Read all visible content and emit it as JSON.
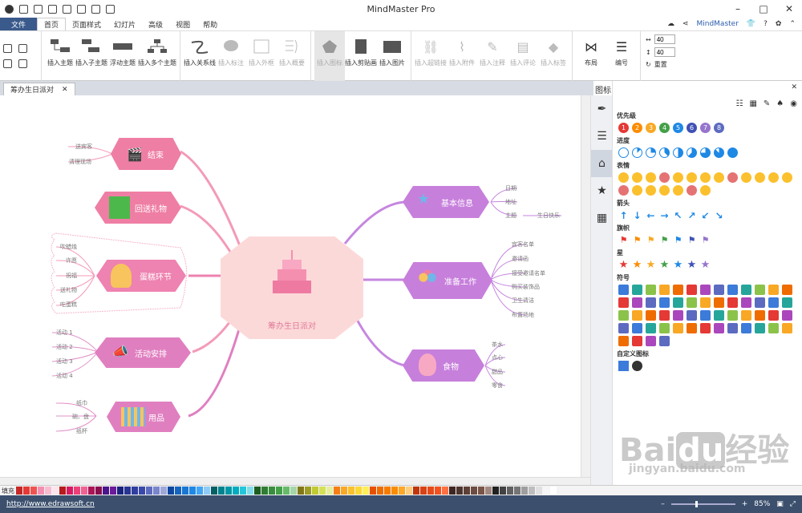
{
  "app": {
    "title": "MindMaster Pro",
    "brand": "MindMaster"
  },
  "menu": {
    "file": "文件",
    "tabs": [
      "首页",
      "页面样式",
      "幻灯片",
      "高级",
      "视图",
      "帮助"
    ]
  },
  "ribbon": {
    "buttons": [
      "插入主题",
      "插入子主题",
      "浮动主题",
      "插入多个主题",
      "插入关系线",
      "插入标注",
      "插入外框",
      "插入概要",
      "插入图标",
      "插入剪贴画",
      "插入图片",
      "插入超链接",
      "插入附件",
      "插入注释",
      "插入评论",
      "插入标签",
      "布局",
      "编号"
    ],
    "width_value": "40",
    "height_value": "40",
    "reset": "重置"
  },
  "doc": {
    "tab": "筹办生日派对"
  },
  "map": {
    "central": "筹办生日派对",
    "branches": [
      {
        "label": "结束",
        "leaves": [
          "送宾客",
          "清理现场"
        ]
      },
      {
        "label": "回送礼物",
        "leaves": []
      },
      {
        "label": "蛋糕环节",
        "leaves": [
          "吹蜡烛",
          "许愿",
          "祝福",
          "送礼物",
          "吃蛋糕"
        ]
      },
      {
        "label": "活动安排",
        "leaves": [
          "活动 1",
          "活动 2",
          "活动 3",
          "活动 4"
        ]
      },
      {
        "label": "用品",
        "leaves": [
          "纸巾",
          "碗、盘",
          "纸杯"
        ]
      },
      {
        "label": "基本信息",
        "leaves": [
          "日期",
          "地址",
          "主题"
        ],
        "extra": "生日快乐"
      },
      {
        "label": "准备工作",
        "leaves": [
          "宾客名单",
          "邀请函",
          "接受邀请名单",
          "购买装饰品",
          "卫生清洁",
          "布置场地"
        ]
      },
      {
        "label": "食物",
        "leaves": [
          "茶水",
          "点心",
          "甜品",
          "零食"
        ]
      }
    ]
  },
  "panel": {
    "title": "图标",
    "sections": [
      "优先级",
      "进度",
      "表情",
      "箭头",
      "旗帜",
      "星",
      "符号",
      "自定义图标"
    ],
    "priority": [
      "1",
      "2",
      "3",
      "4",
      "5",
      "6",
      "7",
      "8"
    ]
  },
  "palette": {
    "label": "填充"
  },
  "status": {
    "url": "http://www.edrawsoft.cn",
    "zoom": "85%"
  },
  "watermark": {
    "text1": "Bai",
    "text2": "du",
    "text3": "经验",
    "sub": "jingyan.baidu.com"
  },
  "colors": {
    "file_bg": "#3a5a8c",
    "status_bg": "#3c506e",
    "pink": "#ef7ea4",
    "violet": "#c77fdc",
    "central_bg": "#fcd9d9"
  }
}
